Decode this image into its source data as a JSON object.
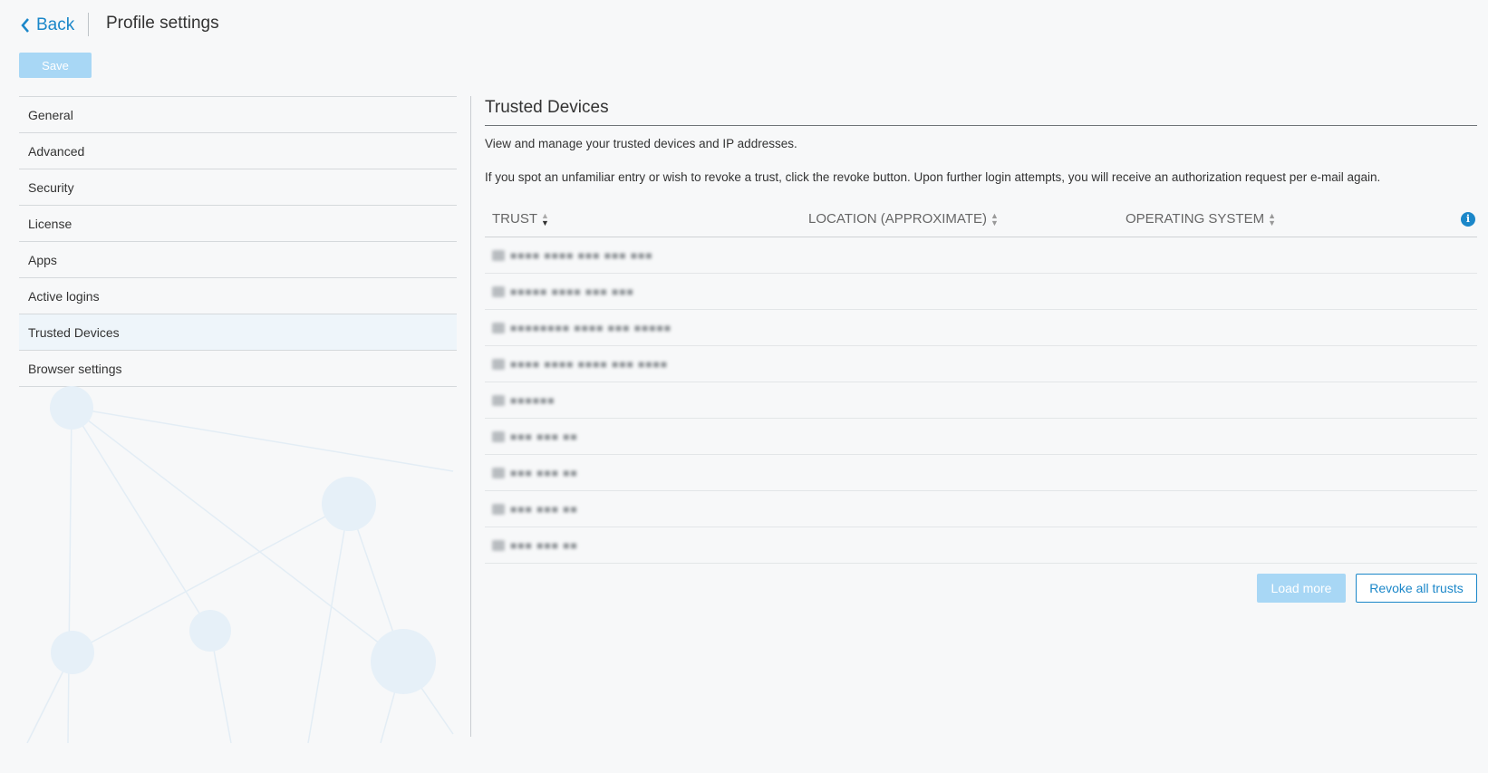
{
  "header": {
    "back_label": "Back",
    "title": "Profile settings",
    "save_label": "Save"
  },
  "sidebar": {
    "items": [
      {
        "label": "General"
      },
      {
        "label": "Advanced"
      },
      {
        "label": "Security"
      },
      {
        "label": "License"
      },
      {
        "label": "Apps"
      },
      {
        "label": "Active logins"
      },
      {
        "label": "Trusted Devices",
        "active": true
      },
      {
        "label": "Browser settings"
      }
    ]
  },
  "main": {
    "title": "Trusted Devices",
    "description": "View and manage your trusted devices and IP addresses.",
    "note": "If you spot an unfamiliar entry or wish to revoke a trust, click the revoke button. Upon further login attempts, you will receive an authorization request per e-mail again.",
    "table": {
      "columns": [
        {
          "label": "TRUST",
          "sort": "desc"
        },
        {
          "label": "LOCATION (APPROXIMATE)",
          "sort": "none"
        },
        {
          "label": "OPERATING SYSTEM",
          "sort": "none"
        }
      ],
      "info_icon": "info-icon",
      "rows": [
        {
          "trust": "■■■■ ■■■■ ■■■ ■■■ ■■■"
        },
        {
          "trust": "■■■■■ ■■■■ ■■■ ■■■"
        },
        {
          "trust": "■■■■■■■■ ■■■■ ■■■ ■■■■■"
        },
        {
          "trust": "■■■■ ■■■■ ■■■■ ■■■ ■■■■"
        },
        {
          "trust": "■■■■■■"
        },
        {
          "trust": "■■■ ■■■ ■■"
        },
        {
          "trust": "■■■ ■■■ ■■"
        },
        {
          "trust": "■■■ ■■■ ■■"
        },
        {
          "trust": "■■■ ■■■ ■■"
        }
      ]
    },
    "load_more_label": "Load more",
    "revoke_all_label": "Revoke all trusts"
  },
  "colors": {
    "accent": "#1b87c9",
    "disabled_button": "#a8d7f5",
    "background": "#f7f8f9"
  }
}
